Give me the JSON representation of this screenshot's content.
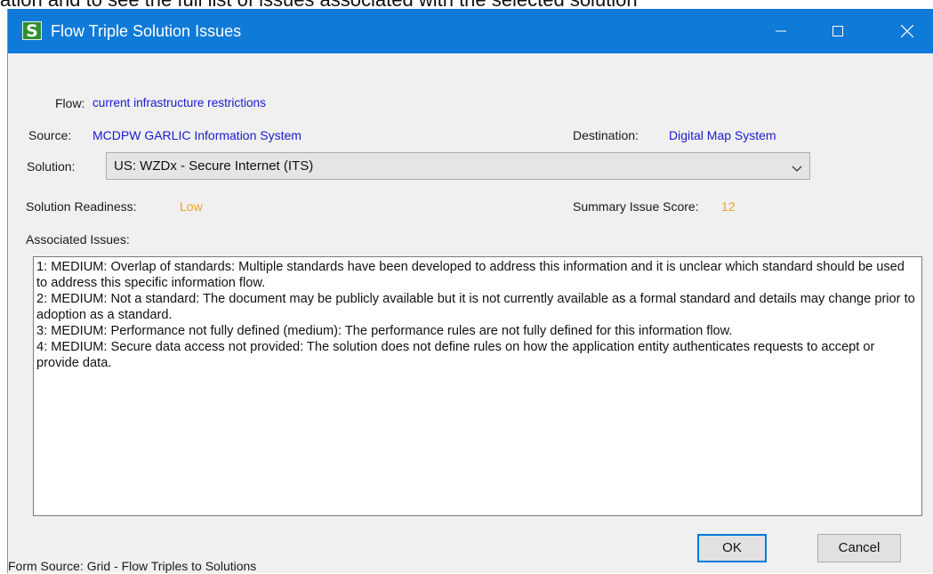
{
  "background_caption": "ation and to see the full list of issues associated with the selected solution",
  "window": {
    "title": "Flow Triple Solution Issues",
    "icon_letter": "S"
  },
  "form": {
    "flow_label": "Flow:",
    "flow_value": "current infrastructure restrictions",
    "source_label": "Source:",
    "source_value": "MCDPW GARLIC Information System",
    "destination_label": "Destination:",
    "destination_value": "Digital Map System",
    "solution_label": "Solution:",
    "solution_value": "US: WZDx - Secure Internet (ITS)",
    "readiness_label": "Solution Readiness:",
    "readiness_value": "Low",
    "score_label": "Summary Issue Score:",
    "score_value": "12",
    "issues_label": "Associated Issues:"
  },
  "issues": [
    "1: MEDIUM: Overlap of standards: Multiple standards have been developed to address this information and it is unclear which standard should be used to address this specific information flow.",
    "2: MEDIUM: Not a standard: The document may be publicly available but it is not currently available as a formal standard and details may change prior to adoption as a standard.",
    "3: MEDIUM: Performance not fully defined (medium): The performance rules are not fully defined for this information flow.",
    "4: MEDIUM: Secure data access not provided: The solution does not define rules on how the application entity authenticates requests to accept or provide data."
  ],
  "buttons": {
    "ok": "OK",
    "cancel": "Cancel"
  },
  "footer": {
    "form_source": "Form Source: Grid - Flow Triples to Solutions"
  },
  "colors": {
    "titlebar": "#0f7ad8",
    "link_value": "#1a1acc",
    "status_value": "#f0a030"
  }
}
